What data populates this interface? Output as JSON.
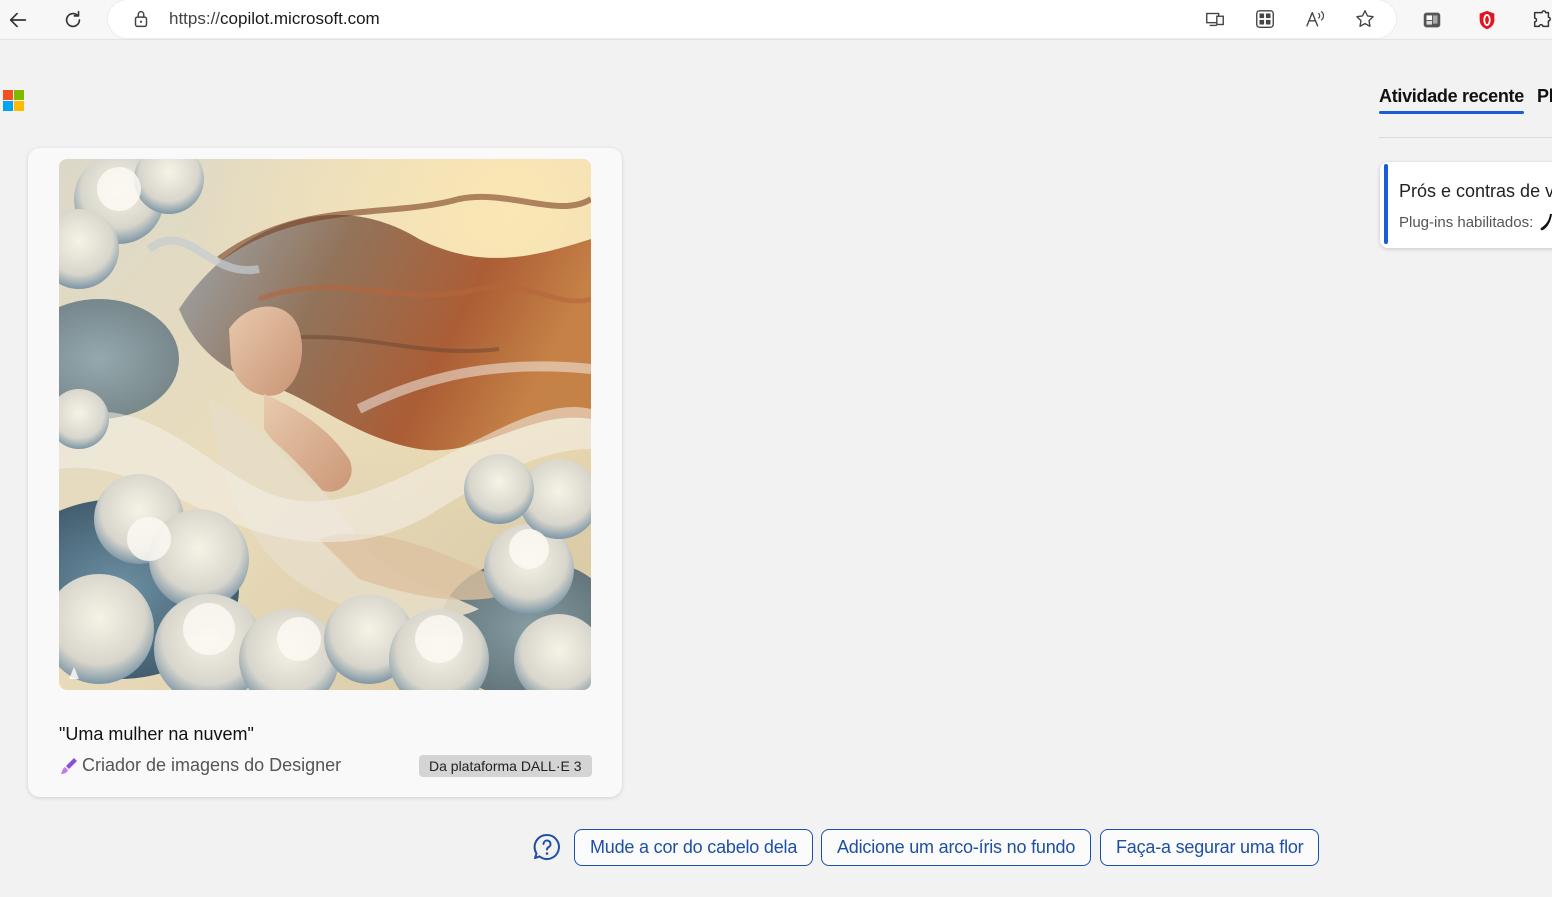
{
  "browser": {
    "url_scheme": "https://",
    "url_host": "copilot.microsoft.com",
    "icons": [
      "back-icon",
      "refresh-icon",
      "lock-icon",
      "app-available-icon",
      "split-screen-icon",
      "read-aloud-icon",
      "favorite-star-icon",
      "workspaces-icon",
      "opera-extension-icon",
      "extensions-icon"
    ]
  },
  "brand": {
    "logo_colors": [
      "#f25022",
      "#7fba00",
      "#00a4ef",
      "#ffb900"
    ],
    "accent": "#1a5bd6"
  },
  "sidebar": {
    "tabs": [
      {
        "label": "Atividade recente"
      },
      {
        "label": "Pl"
      }
    ],
    "recent": {
      "title": "Prós e contras de vi",
      "subtitle": "Plug-ins habilitados:"
    }
  },
  "image_card": {
    "caption": "\"Uma mulher na nuvem\"",
    "creator": "Criador de imagens do Designer",
    "badge": "Da plataforma DALL·E 3"
  },
  "suggestions": [
    {
      "label": "Mude a cor do cabelo dela"
    },
    {
      "label": "Adicione um arco-íris no fundo"
    },
    {
      "label": "Faça-a segurar uma flor"
    }
  ]
}
